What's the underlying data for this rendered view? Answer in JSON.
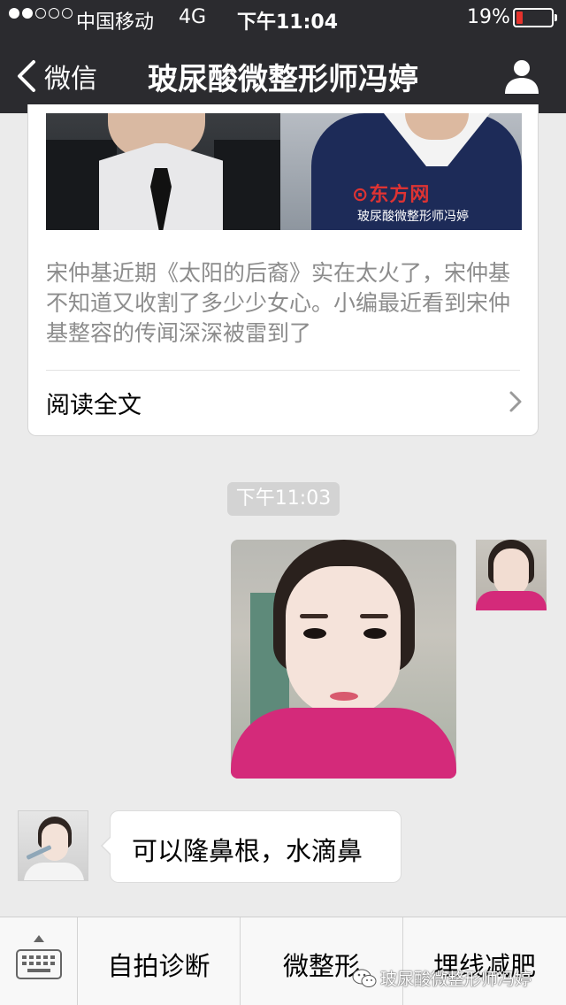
{
  "status_bar": {
    "carrier": "中国移动",
    "network": "4G",
    "time": "下午11:04",
    "battery_percent": "19%",
    "signal_bars_filled": 2,
    "signal_bars_total": 5,
    "battery_level": 0.19,
    "battery_color": "#e5322c"
  },
  "nav": {
    "back_label": "微信",
    "title": "玻尿酸微整形师冯婷",
    "back_icon": "chevron-left-icon",
    "profile_icon": "person-icon"
  },
  "article_card": {
    "cover_watermark_logo": "⊙东方网",
    "cover_watermark_text": "玻尿酸微整形师冯婷",
    "description": "宋仲基近期《太阳的后裔》实在太火了，宋仲基不知道又收割了多少少女心。小编最近看到宋仲基整容的传闻深深被雷到了",
    "read_more_label": "阅读全文"
  },
  "messages": {
    "timestamp": "下午11:03",
    "incoming_text": "可以隆鼻根，水滴鼻"
  },
  "menu": {
    "items": [
      {
        "label": "自拍诊断"
      },
      {
        "label": "微整形"
      },
      {
        "label": "埋线减肥"
      }
    ],
    "keyboard_icon": "keyboard-icon"
  },
  "watermark": {
    "text": "玻尿酸微整形师冯婷"
  },
  "colors": {
    "header_bg": "#2b2b2f",
    "chat_bg": "#ebebeb",
    "timestamp_bg": "#d3d3d3"
  }
}
